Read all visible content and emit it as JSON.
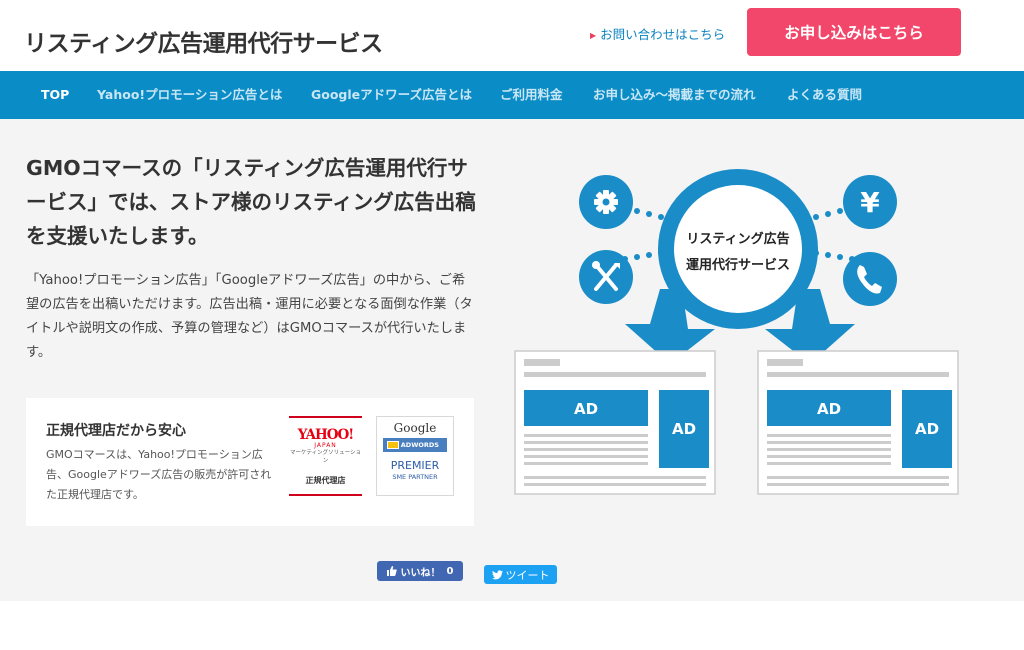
{
  "header": {
    "title": "リスティング広告運用代行サービス",
    "contact_link": "お問い合わせはこちら",
    "apply_button": "お申し込みはこちら"
  },
  "nav": {
    "items": [
      {
        "label": "TOP",
        "active": true
      },
      {
        "label": "Yahoo!プロモーション広告とは",
        "active": false
      },
      {
        "label": "Googleアドワーズ広告とは",
        "active": false
      },
      {
        "label": "ご利用料金",
        "active": false
      },
      {
        "label": "お申し込み〜掲載までの流れ",
        "active": false
      },
      {
        "label": "よくある質問",
        "active": false
      }
    ]
  },
  "hero": {
    "title": "GMOコマースの「リスティング広告運用代行サービス」では、ストア様のリスティング広告出稿を支援いたします。",
    "description": "「Yahoo!プロモーション広告」「Googleアドワーズ広告」の中から、ご希望の広告を出稿いただけます。広告出稿・運用に必要となる面倒な作業（タイトルや説明文の作成、予算の管理など）はGMOコマースが代行いたします。"
  },
  "certification": {
    "title": "正規代理店だから安心",
    "description": "GMOコマースは、Yahoo!プロモーション広告、Googleアドワーズ広告の販売が許可された正規代理店です。",
    "yahoo_badge": {
      "logo": "YAHOO!",
      "logo_sub": "JAPAN",
      "subtitle": "マーケティングソリューション",
      "label": "正規代理店"
    },
    "google_badge": {
      "logo": "Google",
      "product": "ADWORDS",
      "tier": "PREMIER",
      "tier_sub": "SME PARTNER"
    }
  },
  "illustration": {
    "center_line1": "リスティング広告",
    "center_line2": "運用代行サービス",
    "ad_label": "AD",
    "icons": [
      "gear-icon",
      "yen-icon",
      "tools-icon",
      "phone-icon"
    ],
    "yen_symbol": "¥"
  },
  "social": {
    "like_label": "いいね！",
    "like_count": "0",
    "tweet_label": "ツイート"
  },
  "colors": {
    "brand_blue": "#0a8cc6",
    "accent_pink": "#f3466b",
    "link_blue": "#0a82c0",
    "facebook": "#4267b2",
    "twitter": "#1da1f2"
  }
}
